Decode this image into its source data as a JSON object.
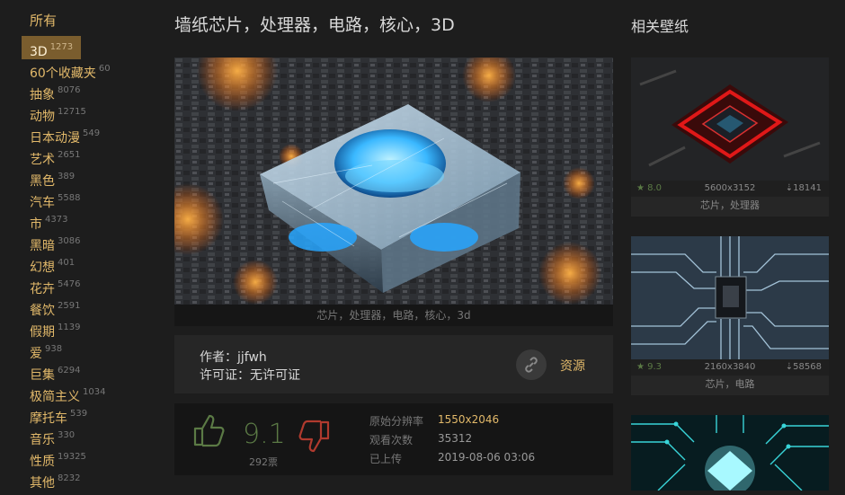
{
  "sidebar": {
    "heading": "所有",
    "categories": [
      {
        "name": "3D",
        "count": "1273",
        "active": true
      },
      {
        "name": "60个收藏夹",
        "count": "60"
      },
      {
        "name": "抽象",
        "count": "8076"
      },
      {
        "name": "动物",
        "count": "12715"
      },
      {
        "name": "日本动漫",
        "count": "549"
      },
      {
        "name": "艺术",
        "count": "2651"
      },
      {
        "name": "黑色",
        "count": "389"
      },
      {
        "name": "汽车",
        "count": "5588"
      },
      {
        "name": "市",
        "count": "4373"
      },
      {
        "name": "黑暗",
        "count": "3086"
      },
      {
        "name": "幻想",
        "count": "401"
      },
      {
        "name": "花卉",
        "count": "5476"
      },
      {
        "name": "餐饮",
        "count": "2591"
      },
      {
        "name": "假期",
        "count": "1139"
      },
      {
        "name": "爱",
        "count": "938"
      },
      {
        "name": "巨集",
        "count": "6294"
      },
      {
        "name": "极简主义",
        "count": "1034"
      },
      {
        "name": "摩托车",
        "count": "539"
      },
      {
        "name": "音乐",
        "count": "330"
      },
      {
        "name": "性质",
        "count": "19325"
      },
      {
        "name": "其他",
        "count": "8232"
      }
    ]
  },
  "main": {
    "title": "墙纸芯片，处理器，电路，核心，3D",
    "caption": "芯片，处理器，电路，核心，3d",
    "author_label": "作者：",
    "author": "jjfwh",
    "license_label": "许可证：",
    "license": "无许可证",
    "resource_label": "资源",
    "score": "9.1",
    "votes": "292票",
    "meta": {
      "res_label": "原始分辨率",
      "res_value": "1550x2046",
      "views_label": "观看次数",
      "views_value": "35312",
      "uploaded_label": "已上传",
      "uploaded_value": "2019-08-06 03:06"
    }
  },
  "related": {
    "heading": "相关壁纸",
    "cards": [
      {
        "rating": "★ 8.0",
        "resolution": "5600x3152",
        "downloads": "⇣18141",
        "caption": "芯片，处理器"
      },
      {
        "rating": "★ 9.3",
        "resolution": "2160x3840",
        "downloads": "⇣58568",
        "caption": "芯片，电路"
      },
      {
        "rating": "",
        "resolution": "",
        "downloads": "",
        "caption": ""
      }
    ]
  },
  "colors": {
    "accent": "#e2b96a",
    "active_bg": "#7a5d2e",
    "like_green": "#5b7a45",
    "dislike_red": "#b03a2e",
    "background": "#1d1d1d"
  },
  "icons": {
    "like": "thumbs-up-icon",
    "dislike": "thumbs-down-icon",
    "resource": "link-icon",
    "star": "star-icon",
    "download": "download-icon"
  }
}
